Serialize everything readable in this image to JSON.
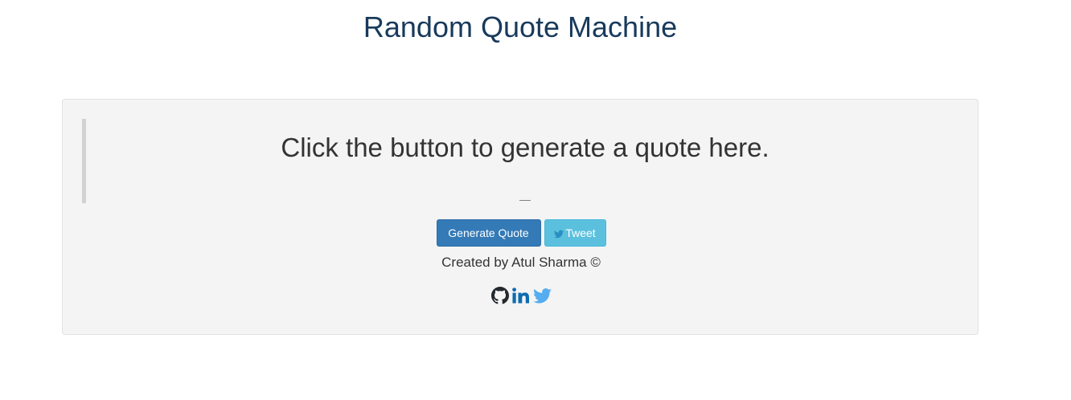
{
  "header": {
    "title": "Random Quote Machine"
  },
  "quote": {
    "text": "Click the button to generate a quote here.",
    "author": "—"
  },
  "actions": {
    "generate_label": "Generate Quote",
    "tweet_label": "Tweet"
  },
  "footer": {
    "credit": "Created by Atul Sharma ©",
    "socials": [
      {
        "icon": "github-icon",
        "color": "#24292e"
      },
      {
        "icon": "linkedin-icon",
        "color": "#0e6bb0"
      },
      {
        "icon": "twitter-icon",
        "color": "#55acee"
      }
    ]
  },
  "colors": {
    "title": "#183a5c",
    "primary": "#337ab7",
    "info": "#5bc0de",
    "well_bg": "#f4f4f4"
  }
}
